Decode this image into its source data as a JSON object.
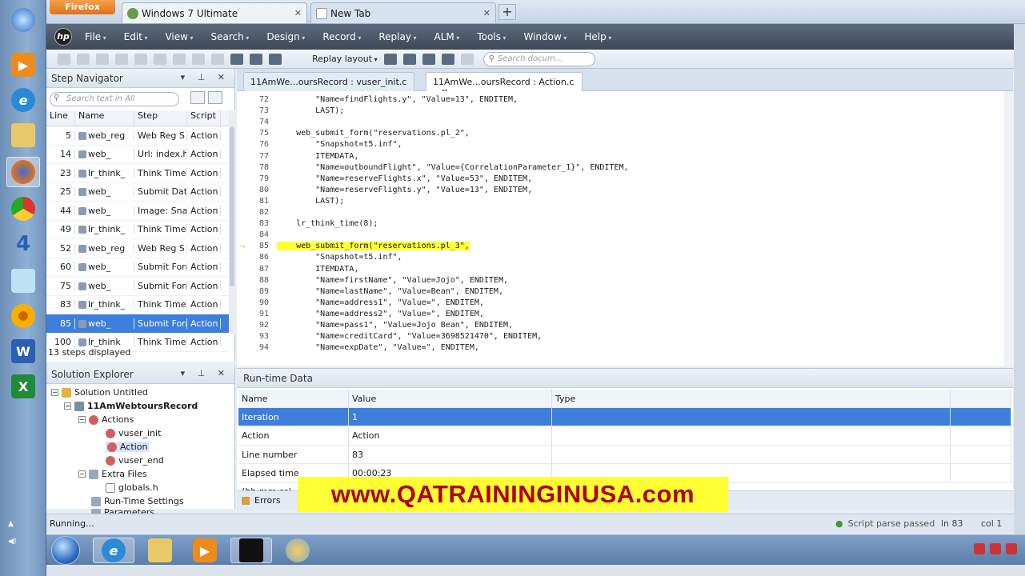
{
  "browser": {
    "button_label": "Firefox",
    "tabs": [
      {
        "label": "Windows 7 Ultimate"
      },
      {
        "label": "New Tab"
      }
    ],
    "new_tab_symbol": "+"
  },
  "menu": [
    "File",
    "Edit",
    "View",
    "Search",
    "Design",
    "Record",
    "Replay",
    "ALM",
    "Tools",
    "Window",
    "Help"
  ],
  "toolbar": {
    "replay_layout": "Replay layout",
    "search_placeholder": "Search docum..."
  },
  "step_navigator": {
    "title": "Step Navigator",
    "search_placeholder": "Search text in All",
    "columns": [
      "Line",
      "Name",
      "Step",
      "Script"
    ],
    "rows": [
      {
        "line": "5",
        "name": "web_reg",
        "step": "Web Reg S",
        "script": "Action"
      },
      {
        "line": "14",
        "name": "web_",
        "step": "Url: index.ht",
        "script": "Action"
      },
      {
        "line": "23",
        "name": "lr_think_",
        "step": "Think Time",
        "script": "Action"
      },
      {
        "line": "25",
        "name": "web_",
        "step": "Submit Data",
        "script": "Action"
      },
      {
        "line": "44",
        "name": "web_",
        "step": "Image: Sna",
        "script": "Action"
      },
      {
        "line": "49",
        "name": "lr_think_",
        "step": "Think Time:",
        "script": "Action"
      },
      {
        "line": "52",
        "name": "web_reg",
        "step": "Web Reg S",
        "script": "Action"
      },
      {
        "line": "60",
        "name": "web_",
        "step": "Submit Forr",
        "script": "Action"
      },
      {
        "line": "75",
        "name": "web_",
        "step": "Submit Forr",
        "script": "Action"
      },
      {
        "line": "83",
        "name": "lr_think_",
        "step": "Think Time",
        "script": "Action"
      },
      {
        "line": "85",
        "name": "web_",
        "step": "Submit Forr",
        "script": "Action"
      },
      {
        "line": "100",
        "name": "lr_think",
        "step": "Think Time",
        "script": "Action"
      }
    ],
    "selected_index": 10,
    "steps_displayed": "13 steps displayed"
  },
  "solution_explorer": {
    "title": "Solution Explorer",
    "items": [
      {
        "label": "Solution Untitled"
      },
      {
        "label": "11AmWebtoursRecord"
      },
      {
        "label": "Actions"
      },
      {
        "label": "vuser_init"
      },
      {
        "label": "Action"
      },
      {
        "label": "vuser_end"
      },
      {
        "label": "Extra Files"
      },
      {
        "label": "globals.h"
      },
      {
        "label": "Run-Time Settings"
      },
      {
        "label": "Parameters"
      }
    ]
  },
  "editor": {
    "tabs": [
      {
        "label": "11AmWe...oursRecord : vuser_init.c"
      },
      {
        "label": "11AmWe...oursRecord : Action.c"
      }
    ],
    "lines": [
      {
        "num": "72",
        "text": "        \"Name=findFlights.y\", \"Value=13\", ENDITEM,"
      },
      {
        "num": "73",
        "text": "        LAST);"
      },
      {
        "num": "74",
        "text": ""
      },
      {
        "num": "75",
        "text": "    web_submit_form(\"reservations.pl_2\","
      },
      {
        "num": "76",
        "text": "        \"Snapshot=t5.inf\","
      },
      {
        "num": "77",
        "text": "        ITEMDATA,"
      },
      {
        "num": "78",
        "text": "        \"Name=outboundFlight\", \"Value={CorrelationParameter_1}\", ENDITEM,"
      },
      {
        "num": "79",
        "text": "        \"Name=reserveFlights.x\", \"Value=53\", ENDITEM,"
      },
      {
        "num": "80",
        "text": "        \"Name=reserveFlights.y\", \"Value=13\", ENDITEM,"
      },
      {
        "num": "81",
        "text": "        LAST);"
      },
      {
        "num": "82",
        "text": ""
      },
      {
        "num": "83",
        "text": "    lr_think_time(8);"
      },
      {
        "num": "84",
        "text": ""
      },
      {
        "num": "85",
        "text": "    web_submit_form(\"reservations.pl_3\","
      },
      {
        "num": "86",
        "text": "        \"Snapshot=t5.inf\","
      },
      {
        "num": "87",
        "text": "        ITEMDATA,"
      },
      {
        "num": "88",
        "text": "        \"Name=firstName\", \"Value=Jojo\", ENDITEM,"
      },
      {
        "num": "89",
        "text": "        \"Name=lastName\", \"Value=Bean\", ENDITEM,"
      },
      {
        "num": "90",
        "text": "        \"Name=address1\", \"Value=\", ENDITEM,"
      },
      {
        "num": "91",
        "text": "        \"Name=address2\", \"Value=\", ENDITEM,"
      },
      {
        "num": "92",
        "text": "        \"Name=pass1\", \"Value=Jojo Bean\", ENDITEM,"
      },
      {
        "num": "93",
        "text": "        \"Name=creditCard\", \"Value=3698521470\", ENDITEM,"
      },
      {
        "num": "94",
        "text": "        \"Name=expDate\", \"Value=\", ENDITEM,"
      }
    ],
    "current_line": "85"
  },
  "runtime": {
    "title": "Run-time Data",
    "columns": [
      "Name",
      "Value",
      "Type"
    ],
    "rows": [
      {
        "name": "Iteration",
        "value": "1",
        "type": ""
      },
      {
        "name": "Action",
        "value": "Action",
        "type": ""
      },
      {
        "name": "Line number",
        "value": "83",
        "type": ""
      },
      {
        "name": "Elapsed time (hh:mm:ss)",
        "value": "00:00:23",
        "type": ""
      }
    ],
    "tabs": [
      "Errors"
    ]
  },
  "watermark": "www.QATRAININGINUSA.com",
  "status": {
    "left": "Running...",
    "parse": "Script parse passed",
    "line": "ln 83",
    "col": "col 1"
  },
  "taskbar_side_label": "4"
}
